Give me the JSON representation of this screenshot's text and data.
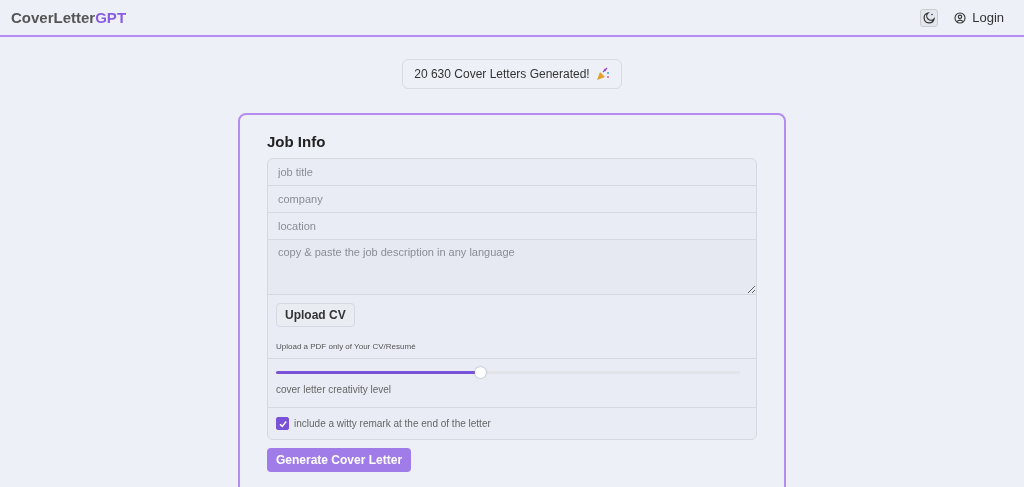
{
  "header": {
    "logo": {
      "main": "CoverLetter",
      "accent": "GPT"
    },
    "login": "Login"
  },
  "counter": {
    "text": "20 630 Cover Letters Generated!"
  },
  "form": {
    "title": "Job Info",
    "fields": [
      {
        "kind": "input",
        "placeholder": "job title"
      },
      {
        "kind": "input",
        "placeholder": "company"
      },
      {
        "kind": "input",
        "placeholder": "location"
      },
      {
        "kind": "textarea",
        "placeholder": "copy & paste the job description in any language"
      }
    ],
    "upload": {
      "button": "Upload CV",
      "hint": "Upload a PDF only of Your CV/Resumé"
    },
    "creativity": {
      "level": 0.44,
      "label": "cover letter creativity level"
    },
    "witty": {
      "checked": true,
      "label": "include a witty remark at the end of the letter"
    },
    "submit": "Generate Cover Letter"
  }
}
